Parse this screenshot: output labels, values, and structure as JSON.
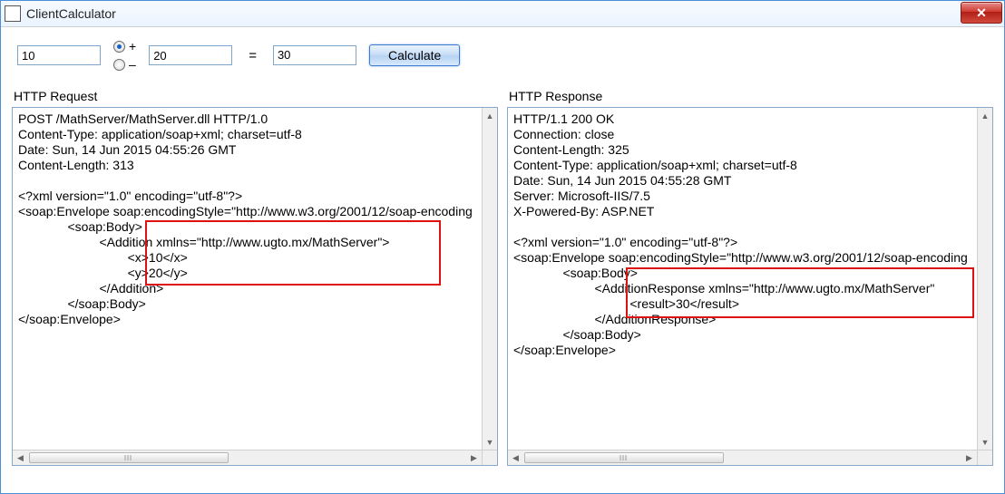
{
  "window": {
    "title": "ClientCalculator",
    "close_glyph": "✕"
  },
  "inputs": {
    "operand1": "10",
    "operand2": "20",
    "result": "30",
    "equals": "=",
    "plus_label": "+",
    "minus_label": "–",
    "operation_selected": "plus",
    "calculate_label": "Calculate"
  },
  "request": {
    "label": "HTTP Request",
    "text": "POST /MathServer/MathServer.dll HTTP/1.0\nContent-Type: application/soap+xml; charset=utf-8\nDate: Sun, 14 Jun 2015 04:55:26 GMT\nContent-Length: 313\n\n<?xml version=\"1.0\" encoding=\"utf-8\"?>\n<soap:Envelope soap:encodingStyle=\"http://www.w3.org/2001/12/soap-encoding\n              <soap:Body>\n                       <Addition xmlns=\"http://www.ugto.mx/MathServer\">\n                               <x>10</x>\n                               <y>20</y>\n                       </Addition>\n              </soap:Body>\n</soap:Envelope>"
  },
  "response": {
    "label": "HTTP Response",
    "text": "HTTP/1.1 200 OK\nConnection: close\nContent-Length: 325\nContent-Type: application/soap+xml; charset=utf-8\nDate: Sun, 14 Jun 2015 04:55:28 GMT\nServer: Microsoft-IIS/7.5\nX-Powered-By: ASP.NET\n\n<?xml version=\"1.0\" encoding=\"utf-8\"?>\n<soap:Envelope soap:encodingStyle=\"http://www.w3.org/2001/12/soap-encoding\n              <soap:Body>\n                       <AdditionResponse xmlns=\"http://www.ugto.mx/MathServer\"\n                                 <result>30</result>\n                       </AdditionResponse>\n              </soap:Body>\n</soap:Envelope>"
  },
  "glyphs": {
    "up": "▲",
    "down": "▼",
    "left": "◀",
    "right": "▶"
  }
}
